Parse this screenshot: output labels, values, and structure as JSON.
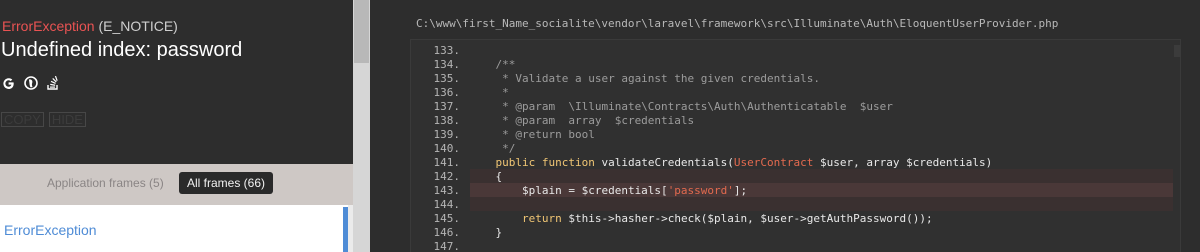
{
  "exception": {
    "class": "ErrorException",
    "code": "(E_NOTICE)",
    "message": "Undefined index: password",
    "search_icons": [
      "google-icon",
      "duckduckgo-icon",
      "stackoverflow-icon"
    ],
    "copy_label": "COPY",
    "hide_label": "HIDE"
  },
  "frames": {
    "tab_application": "Application frames (5)",
    "tab_all": "All frames (66)",
    "first_frame": "ErrorException"
  },
  "editor": {
    "file_path": "C:\\www\\first_Name_socialite\\vendor\\laravel\\framework\\src\\Illuminate\\Auth\\EloquentUserProvider.php",
    "lines": [
      {
        "no": "133.",
        "tokens": [
          {
            "t": "",
            "c": "def"
          }
        ]
      },
      {
        "no": "134.",
        "tokens": [
          {
            "t": "    /**",
            "c": "comment"
          }
        ]
      },
      {
        "no": "135.",
        "tokens": [
          {
            "t": "     * Validate a user against the given credentials.",
            "c": "comment"
          }
        ]
      },
      {
        "no": "136.",
        "tokens": [
          {
            "t": "     *",
            "c": "comment"
          }
        ]
      },
      {
        "no": "137.",
        "tokens": [
          {
            "t": "     * @param  \\Illuminate\\Contracts\\Auth\\Authenticatable  $user",
            "c": "comment"
          }
        ]
      },
      {
        "no": "138.",
        "tokens": [
          {
            "t": "     * @param  array  $credentials",
            "c": "comment"
          }
        ]
      },
      {
        "no": "139.",
        "tokens": [
          {
            "t": "     * @return bool",
            "c": "comment"
          }
        ]
      },
      {
        "no": "140.",
        "tokens": [
          {
            "t": "     */",
            "c": "comment"
          }
        ]
      },
      {
        "no": "141.",
        "tokens": [
          {
            "t": "    ",
            "c": "def"
          },
          {
            "t": "public function",
            "c": "kw"
          },
          {
            "t": " validateCredentials(",
            "c": "def"
          },
          {
            "t": "UserContract",
            "c": "cls"
          },
          {
            "t": " $user, array $credentials)",
            "c": "def"
          }
        ]
      },
      {
        "no": "142.",
        "tokens": [
          {
            "t": "    {",
            "c": "def"
          }
        ]
      },
      {
        "no": "143.",
        "tokens": [
          {
            "t": "        $plain = $credentials[",
            "c": "def"
          },
          {
            "t": "'password'",
            "c": "str"
          },
          {
            "t": "];",
            "c": "def"
          }
        ]
      },
      {
        "no": "144.",
        "tokens": [
          {
            "t": "",
            "c": "def"
          }
        ]
      },
      {
        "no": "145.",
        "tokens": [
          {
            "t": "        ",
            "c": "def"
          },
          {
            "t": "return",
            "c": "kw"
          },
          {
            "t": " $this->hasher->check($plain, $user->getAuthPassword());",
            "c": "def"
          }
        ]
      },
      {
        "no": "146.",
        "tokens": [
          {
            "t": "    }",
            "c": "def"
          }
        ]
      },
      {
        "no": "147.",
        "tokens": [
          {
            "t": "",
            "c": "def"
          }
        ]
      }
    ]
  },
  "colors": {
    "exception_class": "#e95353",
    "accent_blue": "#4f8cd6",
    "keyword": "#f0c674",
    "type_string": "#e36a4f",
    "highlight_row": "#4a3838"
  }
}
